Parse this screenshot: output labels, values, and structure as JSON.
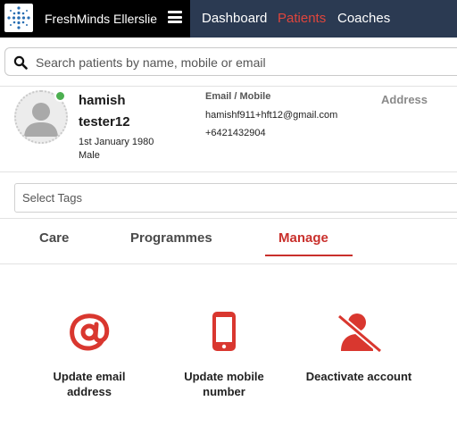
{
  "header": {
    "brand_name": "FreshMinds Ellerslie",
    "nav": [
      "Dashboard",
      "Patients",
      "Coaches"
    ],
    "active_nav": "Patients",
    "accent_color": "#e0453c",
    "bar_color": "#2b3a52"
  },
  "search": {
    "placeholder": "Search patients by name, mobile or email",
    "value": ""
  },
  "profile": {
    "first_name": "hamish",
    "last_name": "tester12",
    "dob": "1st January 1980",
    "gender": "Male",
    "email_mobile_label": "Email / Mobile",
    "email": "hamishf911+hft12@gmail.com",
    "mobile": "+6421432904",
    "address_label": "Address",
    "status": "online"
  },
  "tags": {
    "placeholder": "Select Tags"
  },
  "tabs": [
    "Care",
    "Programmes",
    "Manage"
  ],
  "active_tab": "Manage",
  "actions": [
    {
      "icon": "at-icon",
      "label": "Update email address"
    },
    {
      "icon": "mobile-phone-icon",
      "label": "Update mobile number"
    },
    {
      "icon": "deactivate-user-icon",
      "label": "Deactivate account"
    }
  ],
  "action_color": "#d9372f"
}
